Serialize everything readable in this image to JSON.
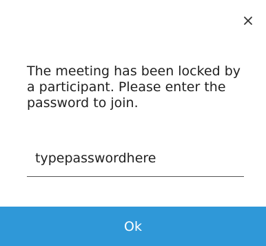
{
  "dialog": {
    "close_icon": "close-icon",
    "message": "The meeting has been locked by a participant. Please enter the password to join.",
    "password_value": "typepasswordhere",
    "ok_label": "Ok"
  },
  "colors": {
    "accent": "#2f98d8",
    "text": "#1f1f1f",
    "background": "#ffffff"
  }
}
